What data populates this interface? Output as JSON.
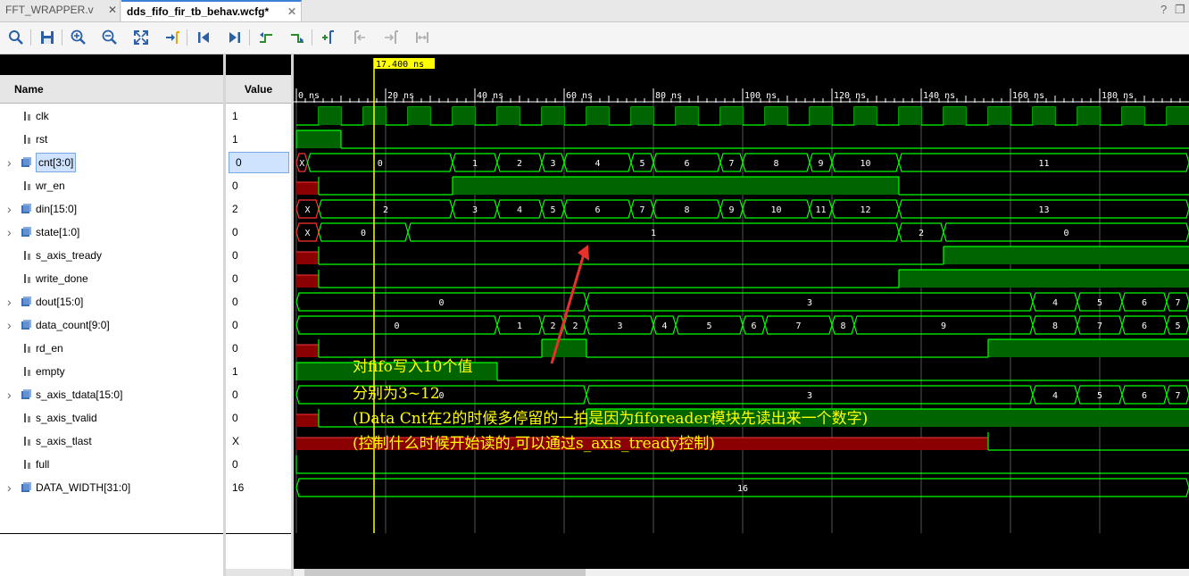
{
  "tabs": [
    {
      "label": "FFT_WRAPPER.v",
      "active": false
    },
    {
      "label": "dds_fifo_fir_tb_behav.wcfg*",
      "active": true
    }
  ],
  "window_controls": {
    "help": "?",
    "restore": "❐"
  },
  "toolbar": {
    "buttons": [
      {
        "name": "search",
        "icon": "magnifier-icon"
      },
      {
        "name": "save",
        "icon": "floppy-icon"
      },
      {
        "name": "zoom-in",
        "icon": "zoom-in-icon"
      },
      {
        "name": "zoom-out",
        "icon": "zoom-out-icon"
      },
      {
        "name": "zoom-fit",
        "icon": "zoom-fit-icon"
      },
      {
        "name": "go-to-cursor",
        "icon": "go-to-cursor-icon"
      },
      {
        "name": "go-to-time-0",
        "icon": "go-to-start-icon"
      },
      {
        "name": "go-to-last-time",
        "icon": "go-to-end-icon"
      },
      {
        "name": "previous-transition",
        "icon": "previous-transition-icon"
      },
      {
        "name": "next-transition",
        "icon": "next-transition-icon"
      },
      {
        "name": "add-marker",
        "icon": "add-marker-icon"
      },
      {
        "name": "previous-marker",
        "icon": "previous-marker-icon"
      },
      {
        "name": "next-marker",
        "icon": "next-marker-icon"
      },
      {
        "name": "swap-cursors",
        "icon": "swap-cursors-icon"
      }
    ]
  },
  "columns": {
    "name": "Name",
    "value": "Value"
  },
  "cursor": {
    "time_label": "17.400 ns",
    "time_ns": 17.4
  },
  "timeline": {
    "ticks": [
      "0 ns",
      "20 ns",
      "40 ns",
      "60 ns",
      "80 ns",
      "100 ns",
      "120 ns",
      "140 ns",
      "160 ns",
      "180 ns"
    ],
    "tick_values_ns": [
      0,
      20,
      40,
      60,
      80,
      100,
      120,
      140,
      160,
      180
    ]
  },
  "colors": {
    "wave": "#00ff00",
    "bus_text": "#ffffff",
    "undefined": "#8b0000",
    "cursor": "#ffff00",
    "annotation": "#ffff00",
    "arrow": "#e8312a"
  },
  "signals": [
    {
      "name": "clk",
      "value": "1",
      "bus": false
    },
    {
      "name": "rst",
      "value": "1",
      "bus": false
    },
    {
      "name": "cnt[3:0]",
      "value": "0",
      "bus": true,
      "selected": true
    },
    {
      "name": "wr_en",
      "value": "0",
      "bus": false
    },
    {
      "name": "din[15:0]",
      "value": "2",
      "bus": true
    },
    {
      "name": "state[1:0]",
      "value": "0",
      "bus": true
    },
    {
      "name": "s_axis_tready",
      "value": "0",
      "bus": false
    },
    {
      "name": "write_done",
      "value": "0",
      "bus": false
    },
    {
      "name": "dout[15:0]",
      "value": "0",
      "bus": true
    },
    {
      "name": "data_count[9:0]",
      "value": "0",
      "bus": true
    },
    {
      "name": "rd_en",
      "value": "0",
      "bus": false
    },
    {
      "name": "empty",
      "value": "1",
      "bus": false
    },
    {
      "name": "s_axis_tdata[15:0]",
      "value": "0",
      "bus": true
    },
    {
      "name": "s_axis_tvalid",
      "value": "0",
      "bus": false
    },
    {
      "name": "s_axis_tlast",
      "value": "X",
      "bus": false
    },
    {
      "name": "full",
      "value": "0",
      "bus": false
    },
    {
      "name": "DATA_WIDTH[31:0]",
      "value": "16",
      "bus": true
    }
  ],
  "waves": {
    "clk": {
      "type": "clock",
      "period_ns": 10,
      "high_first": 2.5
    },
    "rst": {
      "type": "bit",
      "segments": [
        [
          0,
          10,
          1
        ],
        [
          10,
          200,
          0
        ]
      ]
    },
    "cnt[3:0]": {
      "type": "bus",
      "segments": [
        [
          0,
          2.5,
          "X",
          true
        ],
        [
          2.5,
          35,
          "0"
        ],
        [
          35,
          45,
          "1"
        ],
        [
          45,
          55,
          "2"
        ],
        [
          55,
          60,
          "3"
        ],
        [
          60,
          75,
          "4"
        ],
        [
          75,
          80,
          "5"
        ],
        [
          80,
          95,
          "6"
        ],
        [
          95,
          100,
          "7"
        ],
        [
          100,
          115,
          "8"
        ],
        [
          115,
          120,
          "9"
        ],
        [
          120,
          135,
          "10"
        ],
        [
          135,
          200,
          "11"
        ]
      ]
    },
    "wr_en": {
      "type": "bit",
      "segments": [
        [
          0,
          5,
          "U"
        ],
        [
          5,
          35,
          0
        ],
        [
          35,
          135,
          1
        ],
        [
          135,
          200,
          0
        ]
      ]
    },
    "din[15:0]": {
      "type": "bus",
      "segments": [
        [
          0,
          5,
          "X",
          true
        ],
        [
          5,
          35,
          "2"
        ],
        [
          35,
          45,
          "3"
        ],
        [
          45,
          55,
          "4"
        ],
        [
          55,
          60,
          "5"
        ],
        [
          60,
          75,
          "6"
        ],
        [
          75,
          80,
          "7"
        ],
        [
          80,
          95,
          "8"
        ],
        [
          95,
          100,
          "9"
        ],
        [
          100,
          115,
          "10"
        ],
        [
          115,
          120,
          "11"
        ],
        [
          120,
          135,
          "12"
        ],
        [
          135,
          200,
          "13"
        ]
      ]
    },
    "state[1:0]": {
      "type": "bus",
      "segments": [
        [
          0,
          5,
          "X",
          true
        ],
        [
          5,
          25,
          "0"
        ],
        [
          25,
          135,
          "1"
        ],
        [
          135,
          145,
          "2"
        ],
        [
          145,
          200,
          "0"
        ]
      ]
    },
    "s_axis_tready": {
      "type": "bit",
      "segments": [
        [
          0,
          5,
          "U"
        ],
        [
          5,
          145,
          0
        ],
        [
          145,
          200,
          1
        ]
      ]
    },
    "write_done": {
      "type": "bit",
      "segments": [
        [
          0,
          5,
          "U"
        ],
        [
          5,
          135,
          0
        ],
        [
          135,
          200,
          1
        ]
      ]
    },
    "dout[15:0]": {
      "type": "bus",
      "segments": [
        [
          0,
          65,
          "0"
        ],
        [
          65,
          165,
          "3"
        ],
        [
          165,
          175,
          "4"
        ],
        [
          175,
          185,
          "5"
        ],
        [
          185,
          195,
          "6"
        ],
        [
          195,
          200,
          "7"
        ]
      ]
    },
    "data_count[9:0]": {
      "type": "bus",
      "segments": [
        [
          0,
          45,
          "0"
        ],
        [
          45,
          55,
          "1"
        ],
        [
          55,
          60,
          "2"
        ],
        [
          60,
          65,
          "2"
        ],
        [
          65,
          80,
          "3"
        ],
        [
          80,
          85,
          "4"
        ],
        [
          85,
          100,
          "5"
        ],
        [
          100,
          105,
          "6"
        ],
        [
          105,
          120,
          "7"
        ],
        [
          120,
          125,
          "8"
        ],
        [
          125,
          165,
          "9"
        ],
        [
          165,
          175,
          "8"
        ],
        [
          175,
          185,
          "7"
        ],
        [
          185,
          195,
          "6"
        ],
        [
          195,
          200,
          "5"
        ]
      ]
    },
    "rd_en": {
      "type": "bit",
      "segments": [
        [
          0,
          5,
          "U"
        ],
        [
          5,
          55,
          0
        ],
        [
          55,
          65,
          1
        ],
        [
          65,
          155,
          0
        ],
        [
          155,
          200,
          1
        ]
      ]
    },
    "empty": {
      "type": "bit",
      "segments": [
        [
          0,
          45,
          1
        ],
        [
          45,
          200,
          0
        ]
      ]
    },
    "s_axis_tdata[15:0]": {
      "type": "bus",
      "segments": [
        [
          0,
          65,
          "0"
        ],
        [
          65,
          165,
          "3"
        ],
        [
          165,
          175,
          "4"
        ],
        [
          175,
          185,
          "5"
        ],
        [
          185,
          195,
          "6"
        ],
        [
          195,
          200,
          "7"
        ]
      ]
    },
    "s_axis_tvalid": {
      "type": "bit",
      "segments": [
        [
          0,
          5,
          "U"
        ],
        [
          5,
          65,
          0
        ],
        [
          65,
          200,
          1
        ]
      ]
    },
    "s_axis_tlast": {
      "type": "bit",
      "segments": [
        [
          0,
          155,
          "U"
        ],
        [
          155,
          200,
          0
        ]
      ]
    },
    "full": {
      "type": "bit",
      "segments": [
        [
          0,
          200,
          0
        ]
      ]
    },
    "DATA_WIDTH[31:0]": {
      "type": "bus",
      "segments": [
        [
          0,
          200,
          "16"
        ]
      ]
    }
  },
  "annotation": {
    "lines": [
      "对fifo写入10个值",
      "分别为3~12",
      "(Data Cnt在2的时候多停留的一拍是因为fiforeader模块先读出来一个数字)",
      "(控制什么时候开始读的,可以通过s_axis_tready控制)"
    ]
  }
}
